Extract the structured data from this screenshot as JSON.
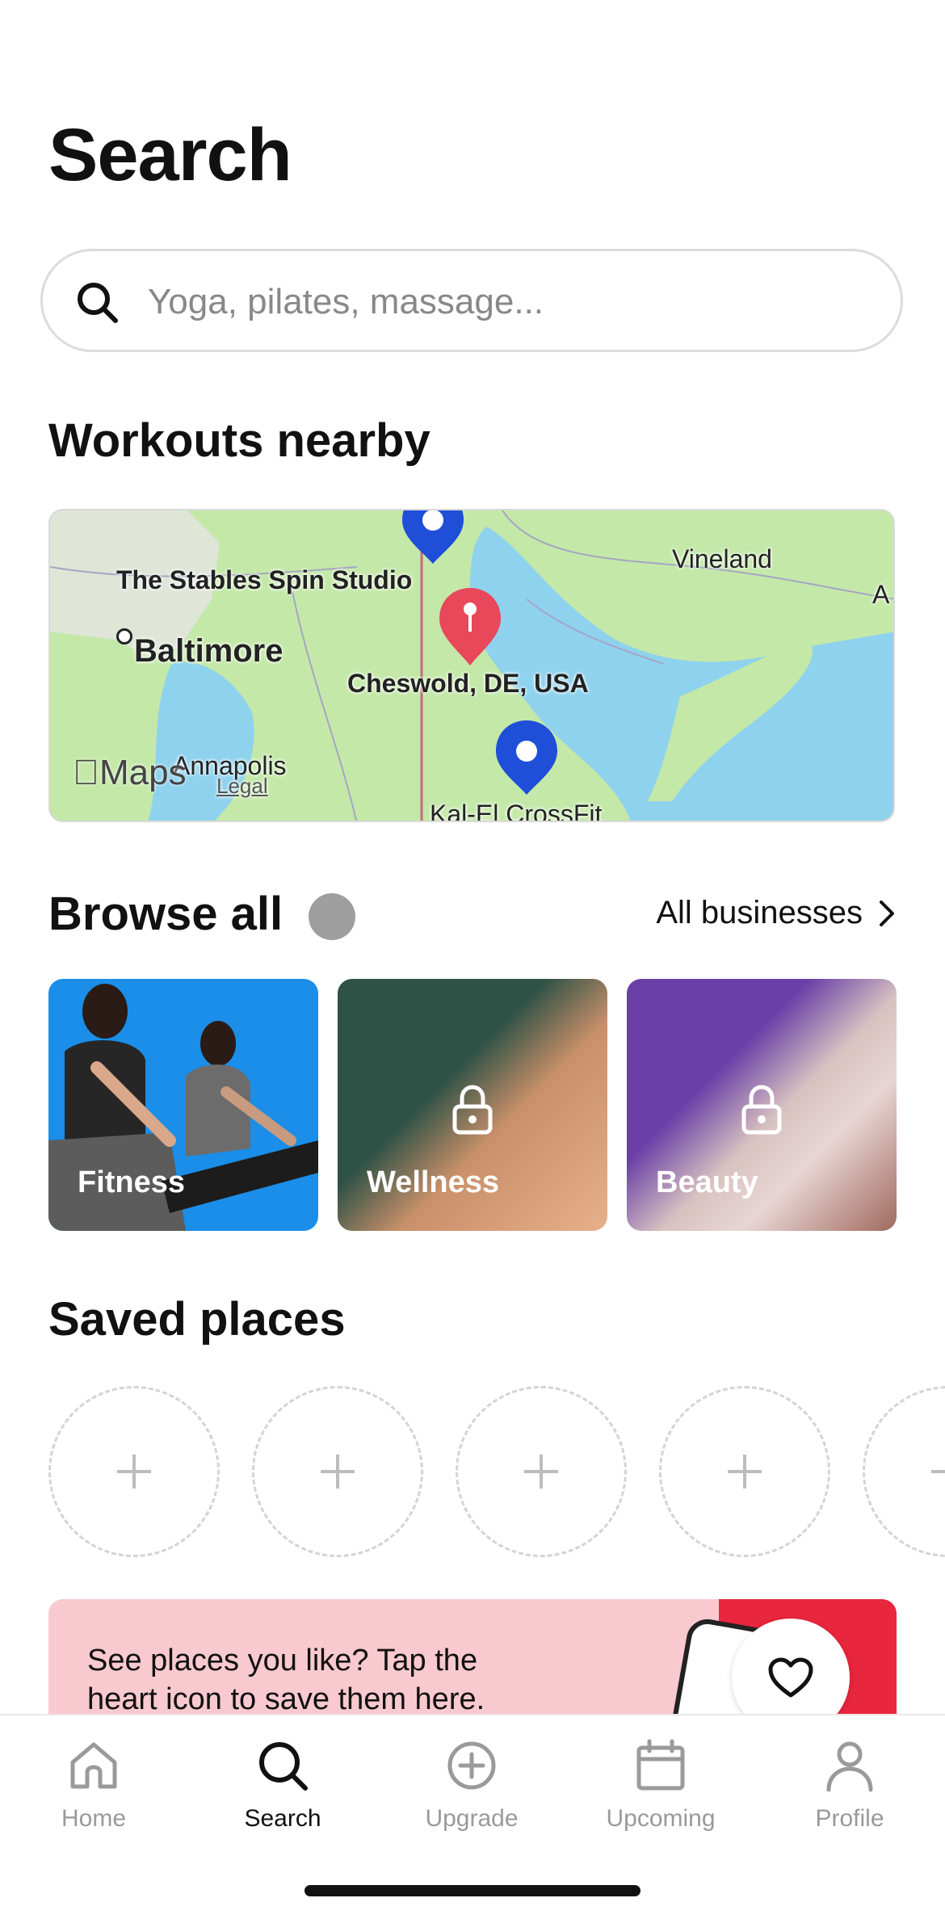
{
  "page": {
    "title": "Search"
  },
  "search": {
    "placeholder": "Yoga, pilates, massage..."
  },
  "workouts": {
    "title": "Workouts nearby",
    "map_labels": {
      "studio": "The Stables Spin Studio",
      "baltimore": "Baltimore",
      "cheswold": "Cheswold, DE, USA",
      "vineland": "Vineland",
      "annapolis": "Annapolis",
      "kalel": "Kal-El CrossFit",
      "edge": "A",
      "maps": "Maps",
      "legal": "Legal"
    }
  },
  "browse": {
    "title": "Browse all",
    "all_link": "All businesses",
    "tiles": [
      {
        "label": "Fitness",
        "locked": false
      },
      {
        "label": "Wellness",
        "locked": true
      },
      {
        "label": "Beauty",
        "locked": true
      }
    ]
  },
  "saved": {
    "title": "Saved places",
    "slot_icon": "plus-icon"
  },
  "promo": {
    "text": "See places you like? Tap the heart icon to save them here."
  },
  "tabs": [
    {
      "label": "Home",
      "icon": "home-icon",
      "active": false
    },
    {
      "label": "Search",
      "icon": "search-icon",
      "active": true
    },
    {
      "label": "Upgrade",
      "icon": "plus-circle-icon",
      "active": false
    },
    {
      "label": "Upcoming",
      "icon": "calendar-icon",
      "active": false
    },
    {
      "label": "Profile",
      "icon": "person-icon",
      "active": false
    }
  ],
  "colors": {
    "pin_blue": "#1f4fd8",
    "pin_red": "#e8485a",
    "promo_bg": "#f9c9d0",
    "promo_red": "#e8263d",
    "inactive_tab": "#9a9a9a"
  }
}
